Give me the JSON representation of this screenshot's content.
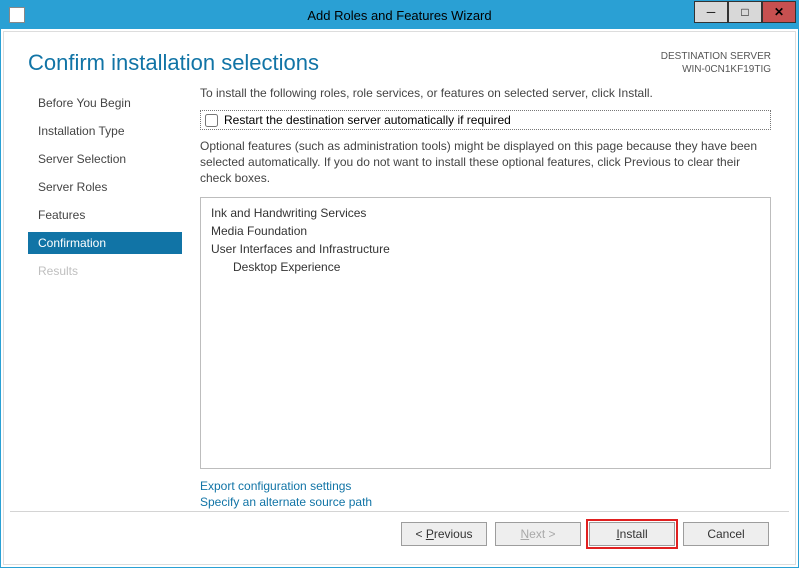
{
  "window": {
    "title": "Add Roles and Features Wizard"
  },
  "header": {
    "page_title": "Confirm installation selections",
    "dest_label": "DESTINATION SERVER",
    "dest_server": "WIN-0CN1KF19TIG"
  },
  "sidebar": {
    "items": [
      {
        "label": "Before You Begin",
        "active": false,
        "disabled": false
      },
      {
        "label": "Installation Type",
        "active": false,
        "disabled": false
      },
      {
        "label": "Server Selection",
        "active": false,
        "disabled": false
      },
      {
        "label": "Server Roles",
        "active": false,
        "disabled": false
      },
      {
        "label": "Features",
        "active": false,
        "disabled": false
      },
      {
        "label": "Confirmation",
        "active": true,
        "disabled": false
      },
      {
        "label": "Results",
        "active": false,
        "disabled": true
      }
    ]
  },
  "main": {
    "install_instruction": "To install the following roles, role services, or features on selected server, click Install.",
    "restart_checkbox_label": "Restart the destination server automatically if required",
    "restart_checked": false,
    "optional_note": "Optional features (such as administration tools) might be displayed on this page because they have been selected automatically. If you do not want to install these optional features, click Previous to clear their check boxes.",
    "features": [
      {
        "label": "Ink and Handwriting Services",
        "indent": 0
      },
      {
        "label": "Media Foundation",
        "indent": 0
      },
      {
        "label": "User Interfaces and Infrastructure",
        "indent": 0
      },
      {
        "label": "Desktop Experience",
        "indent": 1
      }
    ],
    "link_export": "Export configuration settings",
    "link_source": "Specify an alternate source path"
  },
  "footer": {
    "previous": "Previous",
    "next": "Next >",
    "install": "Install",
    "cancel": "Cancel"
  }
}
